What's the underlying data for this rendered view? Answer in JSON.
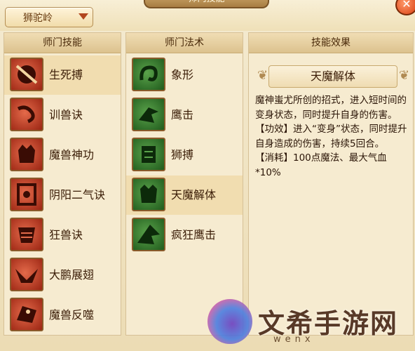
{
  "window": {
    "title": "师门技能"
  },
  "dropdown": {
    "value": "狮驼岭"
  },
  "panels": {
    "school_skills": {
      "header": "师门技能",
      "items": [
        {
          "label": "生死搏",
          "icon": "skull-icon"
        },
        {
          "label": "训兽诀",
          "icon": "whip-icon"
        },
        {
          "label": "魔兽神功",
          "icon": "demon-head-icon"
        },
        {
          "label": "阴阳二气诀",
          "icon": "yinyang-icon"
        },
        {
          "label": "狂兽诀",
          "icon": "beast-icon"
        },
        {
          "label": "大鹏展翅",
          "icon": "wings-icon"
        },
        {
          "label": "魔兽反噬",
          "icon": "fang-icon"
        }
      ]
    },
    "school_spells": {
      "header": "师门法术",
      "items": [
        {
          "label": "象形",
          "icon": "elephant-icon"
        },
        {
          "label": "鹰击",
          "icon": "eagle-icon"
        },
        {
          "label": "狮搏",
          "icon": "lion-icon"
        },
        {
          "label": "天魔解体",
          "icon": "demon-transform-icon"
        },
        {
          "label": "疯狂鹰击",
          "icon": "frenzy-eagle-icon"
        }
      ]
    },
    "effect": {
      "header": "技能效果",
      "skill_name": "天魔解体",
      "description": "魔神蚩尤所创的招式，进入短时间的变身状态，同时提升自身的伤害。",
      "effect_line": "【功效】进入“变身”状态，同时提升自身造成的伤害，持续5回合。",
      "cost_line": "【消耗】100点魔法、最大气血*10%"
    }
  },
  "watermark": {
    "text": "文希手游网",
    "sub": "wenx"
  },
  "colors": {
    "selected_row": "#f1ddb0",
    "panel_bg": "#f6ebd0",
    "icon_red": "#c24a2e",
    "icon_green": "#2f7a2a"
  }
}
